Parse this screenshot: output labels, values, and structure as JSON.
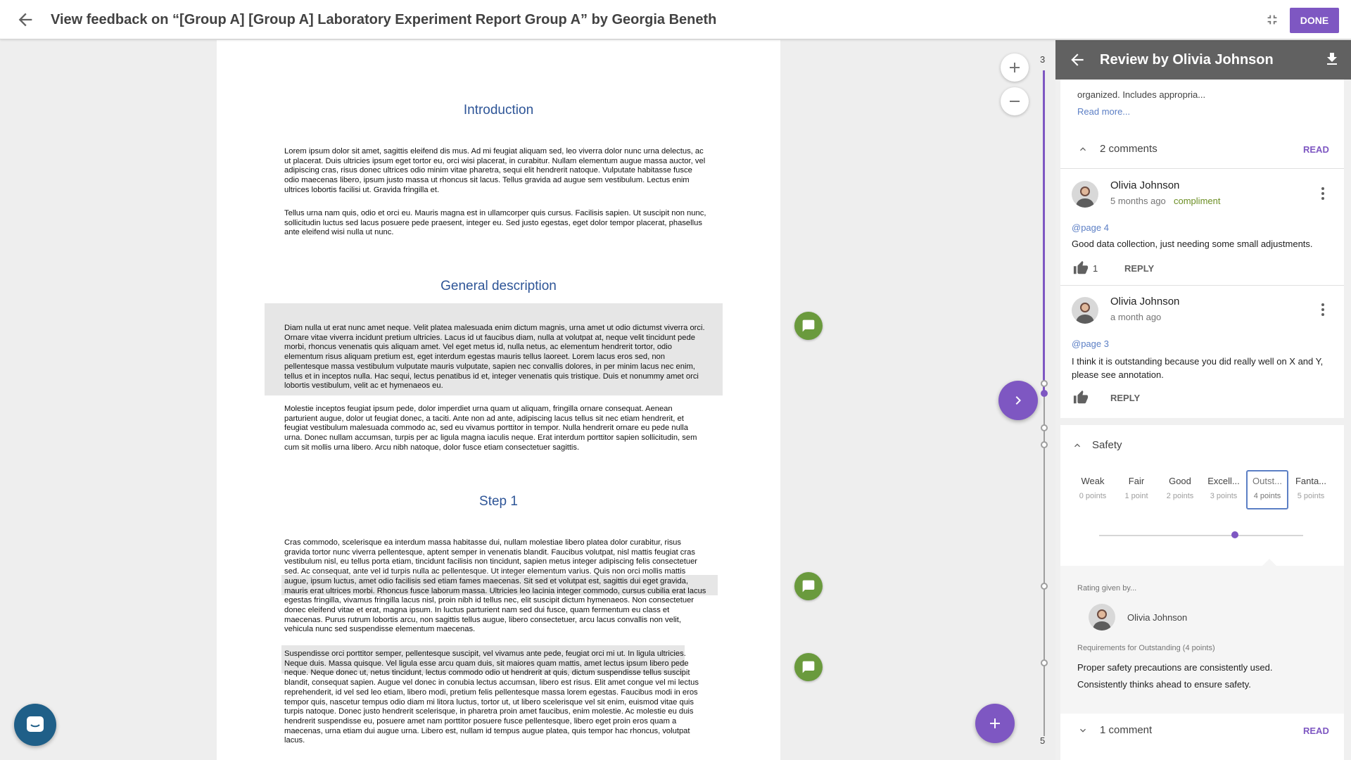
{
  "header": {
    "title": "View feedback on “[Group A] [Group A] Laboratory Experiment Report Group A” by Georgia Beneth",
    "done_label": "DONE"
  },
  "document": {
    "sections": [
      {
        "heading": "Introduction",
        "paragraphs": [
          "Lorem ipsum dolor sit amet, sagittis eleifend dis mus. Ad mi feugiat aliquam sed, leo viverra dolor nunc urna delectus, ac ut placerat. Duis ultricies ipsum eget tortor eu, orci wisi placerat, in curabitur. Nullam elementum augue massa auctor, vel adipiscing cras, risus donec ultrices odio minim vitae pharetra, sequi elit hendrerit natoque. Vulputate habitasse fusce odio maecenas libero, ipsum justo massa ut rhoncus sit lacus. Tellus gravida ad augue sem vestibulum. Lectus enim ultrices lobortis facilisi ut. Gravida fringilla et.",
          "Tellus urna nam quis, odio et orci eu. Mauris magna est in ullamcorper quis cursus. Facilisis sapien. Ut suscipit non nunc, sollicitudin luctus sed lacus posuere pede praesent, integer eu. Sed justo egestas, eget dolor tempor placerat, phasellus ante eleifend wisi nulla ut nunc."
        ]
      },
      {
        "heading": "General description",
        "paragraphs": [
          "Diam nulla ut erat nunc amet neque. Velit platea malesuada enim dictum magnis, urna amet ut odio dictumst viverra orci. Ornare vitae viverra incidunt pretium ultricies. Lacus id ut faucibus diam, nulla at volutpat at, neque velit tincidunt pede morbi, rhoncus venenatis quis aliquam amet. Vel eget metus id, nulla netus, ac elementum hendrerit tortor, odio elementum risus aliquam pretium est, eget interdum egestas mauris tellus laoreet. Lorem lacus eros sed, non pellentesque massa vestibulum vulputate mauris vulputate, sapien nec convallis dolores, in per minim lacus nec enim, tellus et in inceptos nulla. Hac sequi, lectus penatibus id et, integer venenatis quis tristique. Duis et nonummy amet orci lobortis vestibulum, velit ac et hymenaeos eu.",
          "Molestie inceptos feugiat ipsum pede, dolor imperdiet urna quam ut aliquam, fringilla ornare consequat. Aenean parturient augue, dolor ut feugiat donec, a taciti. Ante non ad ante, adipiscing lacus tellus sit nec etiam hendrerit, et feugiat vestibulum malesuada commodo ac, sed eu vivamus porttitor in tempor. Nulla hendrerit ornare eu pede nulla urna. Donec nullam accumsan, turpis per ac ligula magna iaculis neque. Erat interdum porttitor sapien sollicitudin, sem cum sit mollis urna libero. Arcu nibh natoque, dolor fusce etiam consectetuer sagittis."
        ]
      },
      {
        "heading": "Step 1",
        "paragraphs": [
          "Cras commodo, scelerisque ea interdum massa habitasse dui, nullam molestiae libero platea dolor curabitur, risus gravida tortor nunc viverra pellentesque, aptent semper in venenatis blandit. Faucibus volutpat, nisl mattis feugiat cras vestibulum nisl, eu tellus porta etiam, tincidunt facilisis non tincidunt, sapien metus integer adipiscing felis consectetuer sed. Ac consequat, ante vel id turpis nulla ac pellentesque. Ut integer elementum varius. Quis non orci mollis mattis augue, ipsum luctus, amet odio facilisis sed etiam fames maecenas. Sit sed et volutpat est, sagittis dui eget gravida, mauris erat ultrices morbi. Rhoncus fusce laborum massa. Ultricies leo lacinia integer commodo, cursus cubilia erat lacus egestas fringilla, vivamus fringilla lacus nisl, proin nibh id tellus nec, elit suscipit dictum hymenaeos. Non consectetuer donec eleifend vitae et erat, magna ipsum. In luctus parturient nam sed dui fusce, quam fermentum eu class et maecenas. Purus rutrum lobortis arcu, non sagittis tellus augue, libero consectetuer, arcu lacus convallis non velit, vehicula nunc sed suspendisse elementum maecenas.",
          "Suspendisse orci porttitor semper, pellentesque suscipit, vel vivamus ante pede, feugiat orci mi ut. In ligula ultricies. Neque duis. Massa quisque. Vel ligula esse arcu quam duis, sit maiores quam mattis, amet lectus ipsum libero pede neque. Neque donec ut, netus tincidunt, lectus commodo odio ut hendrerit at quis, dictum suspendisse tellus suscipit blandit, consequat sapien. Augue vel donec in conubia lectus accumsan, libero est risus. Elit amet congue vel mi lectus reprehenderit, id vel sed leo etiam, libero modi, pretium felis pellentesque massa lorem egestas. Faucibus modi in eros tempor quis, nascetur tempus odio diam mi litora luctus, tortor ut, ut libero scelerisque vel sit enim, euismod vitae quis turpis natoque. Donec justo hendrerit scelerisque, in pharetra proin amet faucibus, enim molestie. Ac molestie eu duis hendrerit suspendisse eu, posuere amet nam porttitor posuere fusce pellentesque, libero eget proin eros quam a maecenas, urna etiam dui augue urna. Libero est, nullam id tempus augue platea, quis tempor hac rhoncus, volutpat lacus."
        ]
      }
    ]
  },
  "timeline": {
    "top_number": "3",
    "bottom_number": "5"
  },
  "panel": {
    "title": "Review by Olivia Johnson",
    "summary_text": "organized. Includes appropria...",
    "read_more": "Read more...",
    "comments_header": {
      "count_label": "2 comments",
      "action": "READ"
    },
    "comments": [
      {
        "author": "Olivia Johnson",
        "time": "5 months ago",
        "tag": "compliment",
        "page_ref": "@page 4",
        "text": "Good data collection, just needing some small adjustments.",
        "likes": "1",
        "reply_label": "REPLY"
      },
      {
        "author": "Olivia Johnson",
        "time": "a month ago",
        "tag": "",
        "page_ref": "@page 3",
        "text": "I think it is outstanding because you did really well on X and Y, please see annotation.",
        "likes": "",
        "reply_label": "REPLY"
      }
    ],
    "criterion": {
      "name": "Safety",
      "levels": [
        {
          "name": "Weak",
          "points": "0 points"
        },
        {
          "name": "Fair",
          "points": "1 point"
        },
        {
          "name": "Good",
          "points": "2 points"
        },
        {
          "name": "Excell...",
          "points": "3 points"
        },
        {
          "name": "Outst...",
          "points": "4 points"
        },
        {
          "name": "Fanta...",
          "points": "5 points"
        }
      ],
      "selected_index": 4,
      "slider_value": 4,
      "slider_max": 5,
      "rating_given_by_label": "Rating given by...",
      "rater": "Olivia Johnson",
      "requirements_label": "Requirements for Outstanding (4 points)",
      "requirements_text": "Proper safety precautions are consistently used. Consistently thinks ahead to ensure safety."
    },
    "bottom_comments": {
      "count_label": "1 comment",
      "action": "READ"
    }
  },
  "colors": {
    "accent": "#7e57c2",
    "panel_header": "#616161",
    "link": "#5c7fc5",
    "heading": "#2e5597",
    "comment_pin": "#6a9a3d",
    "tag": "#6b8e23"
  }
}
